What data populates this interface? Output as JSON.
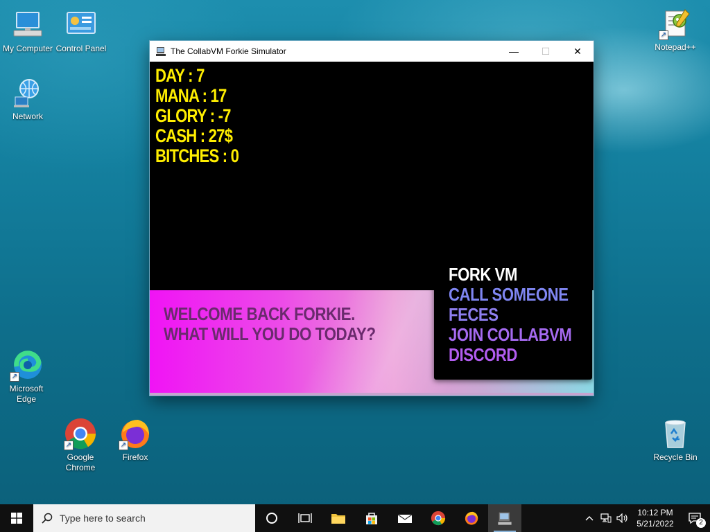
{
  "desktop": {
    "icons": [
      {
        "id": "my-computer",
        "label": "My Computer"
      },
      {
        "id": "control-panel",
        "label": "Control Panel"
      },
      {
        "id": "network",
        "label": "Network"
      },
      {
        "id": "notepad",
        "label": "Notepad++"
      },
      {
        "id": "edge",
        "label": "Microsoft Edge"
      },
      {
        "id": "chrome",
        "label": "Google Chrome"
      },
      {
        "id": "firefox",
        "label": "Firefox"
      },
      {
        "id": "recycle-bin",
        "label": "Recycle Bin"
      }
    ]
  },
  "window": {
    "title": "The CollabVM Forkie Simulator",
    "controls": {
      "minimize": "—",
      "maximize": "☐",
      "close": "✕"
    }
  },
  "game": {
    "stats": [
      "DAY : 7",
      "MANA : 17",
      "GLORY : -7",
      "CASH : 27$",
      "BITCHES : 0"
    ],
    "welcome": [
      "WELCOME BACK FORKIE.",
      "WHAT WILL YOU DO TODAY?"
    ],
    "menu": [
      {
        "label": "FORK VM",
        "color": "#ffffff"
      },
      {
        "label": "CALL SOMEONE",
        "color": "#7f86f2"
      },
      {
        "label": "FECES",
        "color": "#8f7ff0"
      },
      {
        "label": "JOIN COLLABVM",
        "color": "#a56af0"
      },
      {
        "label": "DISCORD",
        "color": "#b25df0"
      }
    ]
  },
  "taskbar": {
    "search_placeholder": "Type here to search",
    "time": "10:12 PM",
    "date": "5/21/2022",
    "notification_count": "2"
  }
}
